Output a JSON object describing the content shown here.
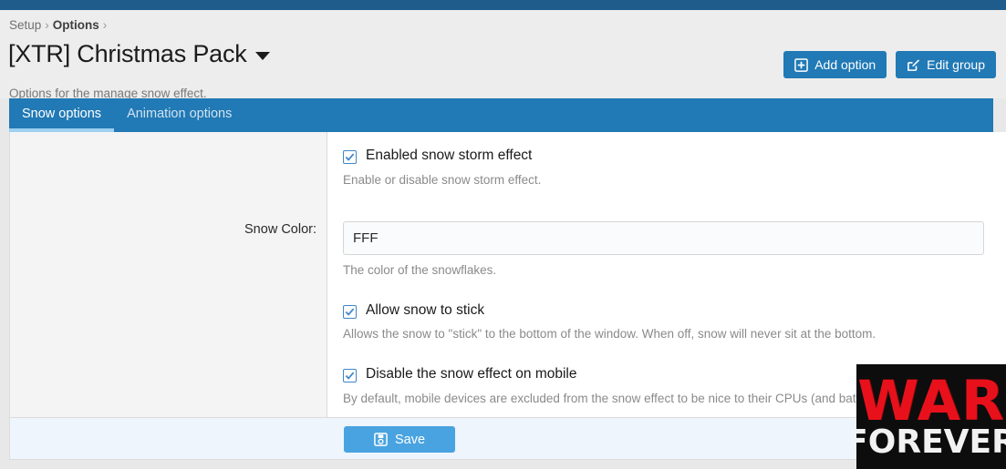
{
  "topbar": {
    "color": "#1f5c8b"
  },
  "breadcrumb": {
    "setup": "Setup",
    "options": "Options",
    "separator": "›"
  },
  "header": {
    "title": "[XTR] Christmas Pack",
    "description": "Options for the manage snow effect.",
    "actions": [
      {
        "label": "Add option",
        "icon": "plus-square-icon"
      },
      {
        "label": "Edit group",
        "icon": "edit-square-icon"
      }
    ]
  },
  "tabs": [
    {
      "label": "Snow options",
      "active": true
    },
    {
      "label": "Animation options",
      "active": false
    }
  ],
  "form": {
    "snow_color_label": "Snow Color:",
    "fields": [
      {
        "type": "checkbox",
        "label": "Enabled snow storm effect",
        "checked": true,
        "hint": "Enable or disable snow storm effect."
      },
      {
        "type": "text",
        "value": "FFF",
        "placeholder": "",
        "hint": "The color of the snowflakes."
      },
      {
        "type": "checkbox",
        "label": "Allow snow to stick",
        "checked": true,
        "hint": "Allows the snow to \"stick\" to the bottom of the window. When off, snow will never sit at the bottom."
      },
      {
        "type": "checkbox",
        "label": "Disable the snow effect on mobile",
        "checked": true,
        "hint": "By default, mobile devices are excluded from the snow effect to be nice to their CPUs (and batteries)"
      }
    ]
  },
  "footer": {
    "save_label": "Save",
    "save_icon": "save-floppy-icon"
  },
  "watermark": {
    "line1": "WAR",
    "line2": "FOREVER",
    "line1_color": "#e8111b",
    "line2_color": "#f2f2f2",
    "background": "#0d0d0d"
  },
  "colors": {
    "accent_dark": "#1f5c8b",
    "accent": "#2179b5",
    "accent_light": "#49a3e0",
    "tab_underline": "#9ed0f0"
  }
}
